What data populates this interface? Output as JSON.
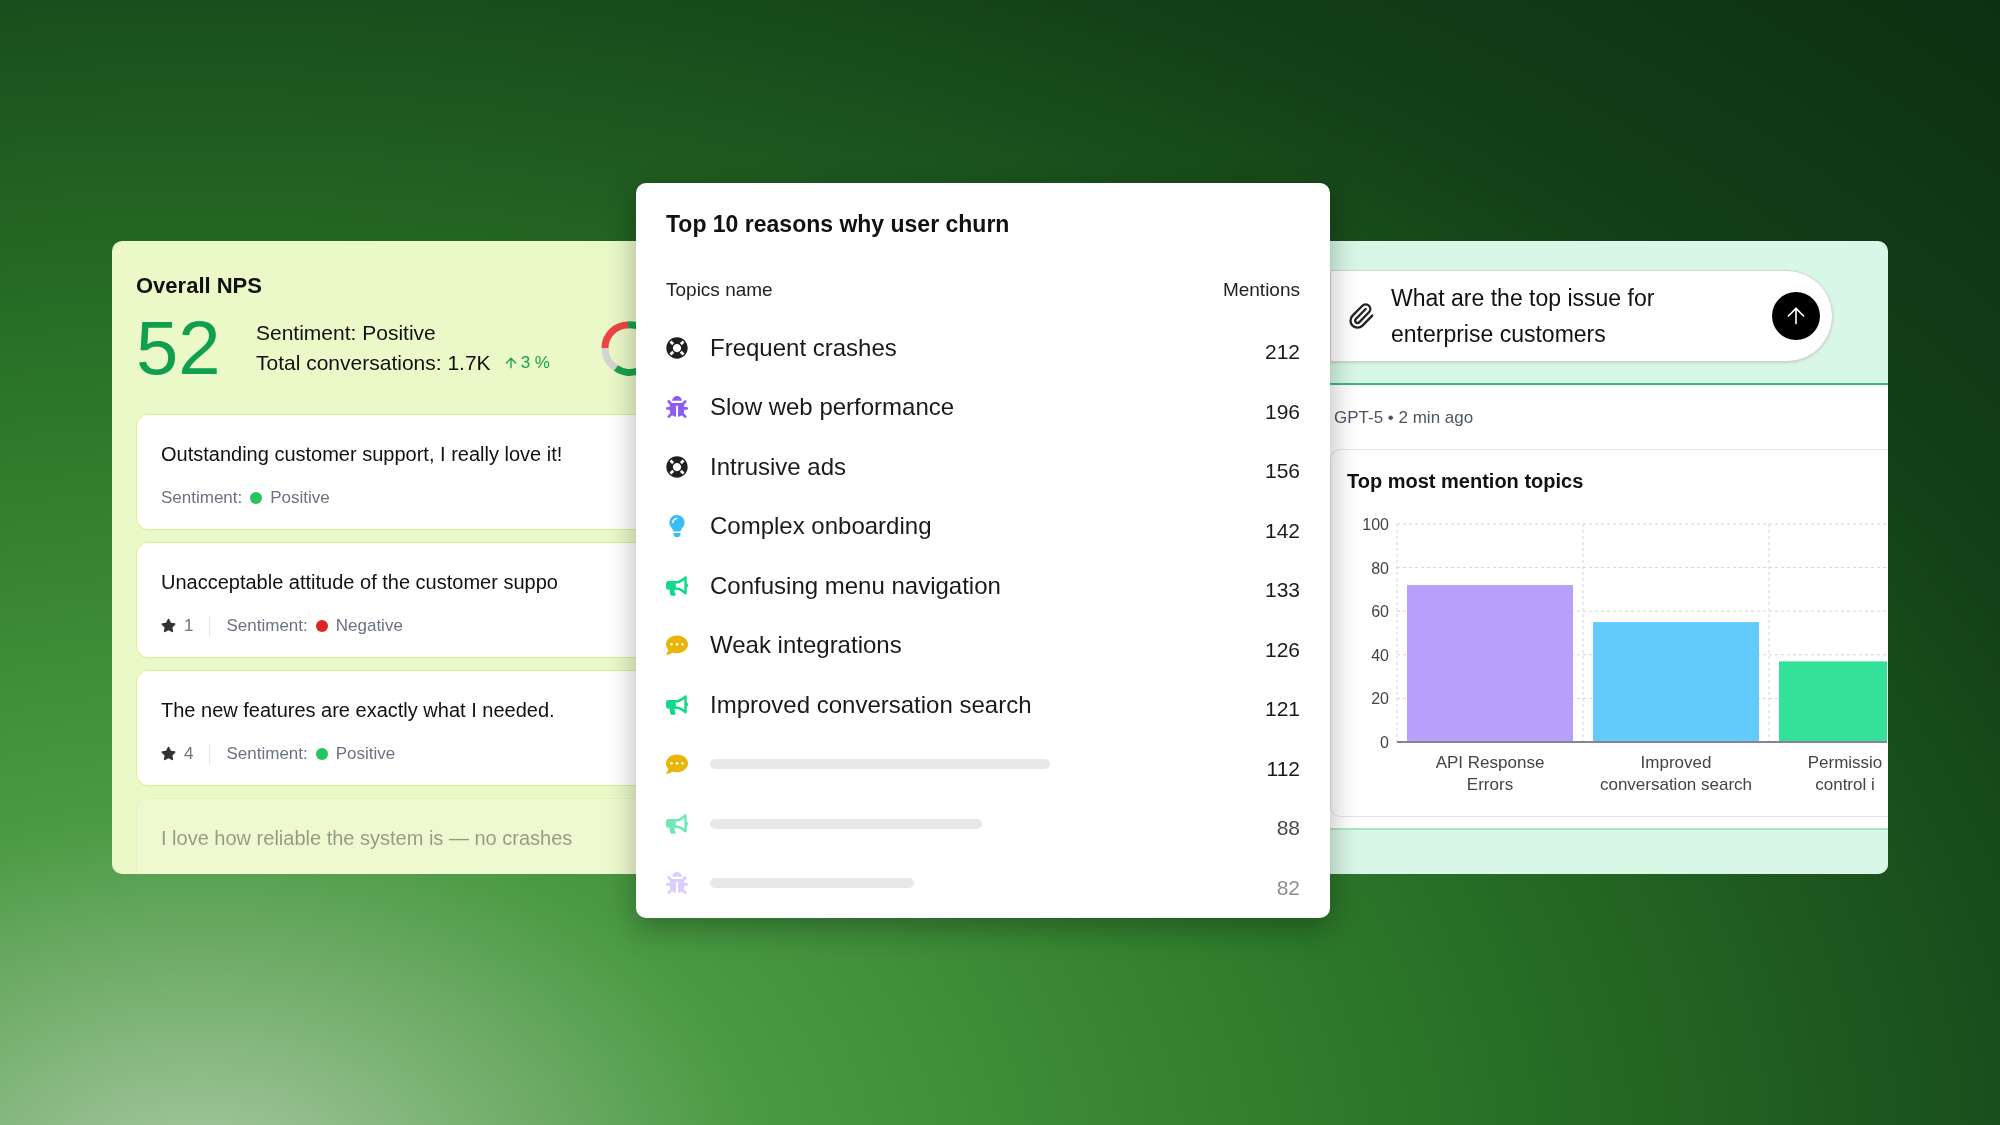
{
  "nps": {
    "title": "Overall NPS",
    "score": "52",
    "sentiment": "Sentiment: Positive",
    "total": "Total conversations: 1.7K",
    "trend": "3 %"
  },
  "reviews": [
    {
      "text": "Outstanding customer support, I really love it!",
      "sentiment_label": "Sentiment:",
      "sentiment": "Positive",
      "color": "#22c55e",
      "faded": false
    },
    {
      "text": "Unacceptable attitude of the customer suppo",
      "rating": "1",
      "sentiment_label": "Sentiment:",
      "sentiment": "Negative",
      "color": "#dc2626",
      "faded": false
    },
    {
      "text": "The new features are exactly what I needed.",
      "rating": "4",
      "sentiment_label": "Sentiment:",
      "sentiment": "Positive",
      "color": "#22c55e",
      "faded": false
    },
    {
      "text": "I love how reliable the system is — no crashes",
      "faded": true
    }
  ],
  "churn": {
    "title": "Top 10 reasons why user churn",
    "columns": [
      "Topics name",
      "Mentions"
    ],
    "rows": [
      {
        "kind": "lifebuoy",
        "name": "Frequent crashes",
        "mentions": "212"
      },
      {
        "kind": "bug",
        "name": "Slow web performance",
        "mentions": "196"
      },
      {
        "kind": "lifebuoy",
        "name": "Intrusive ads",
        "mentions": "156"
      },
      {
        "kind": "bulb",
        "name": "Complex onboarding",
        "mentions": "142"
      },
      {
        "kind": "megaphone",
        "name": "Confusing menu navigation",
        "mentions": "133"
      },
      {
        "kind": "chat",
        "name": "Weak integrations",
        "mentions": "126"
      },
      {
        "kind": "megaphone",
        "name": "Improved conversation search",
        "mentions": "121"
      },
      {
        "kind": "chat",
        "mentions": "112"
      },
      {
        "kind": "megaphone",
        "mentions": "88"
      },
      {
        "kind": "bug",
        "mentions": "82"
      }
    ]
  },
  "assistant": {
    "chat": {
      "value": "What are the top issue for enterprise customers"
    },
    "meta": "GPT-5 • 2 min ago",
    "chart_panel": {
      "chart_data": {
        "type": "bar",
        "title": "Top most mention topics",
        "stacked": true,
        "grid": true,
        "categories": [
          "API Response\nErrors",
          "Improved\nconversation search",
          "Permissio\ncontrol i"
        ],
        "series": [
          {
            "color": "#b89ffb",
            "values": [
              72,
              null,
              null
            ]
          },
          {
            "color": "#63cbfb",
            "values": [
              null,
              55,
              null
            ]
          },
          {
            "color": "#34e199",
            "values": [
              null,
              null,
              37
            ]
          }
        ],
        "ylim": [
          0,
          100
        ],
        "yticks": [
          0,
          20,
          40,
          60,
          80,
          100
        ]
      }
    }
  }
}
